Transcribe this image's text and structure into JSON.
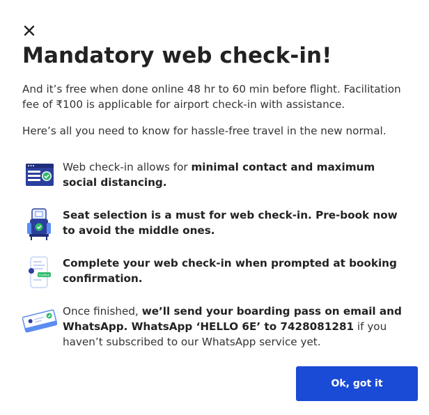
{
  "dialog": {
    "close_icon": "close-icon",
    "title": "Mandatory web check-in!",
    "intro": "And it’s free when done online 48 hr to 60 min before flight. Facilitation fee of ₹100 is applicable for airport check-in with assistance.",
    "subintro": "Here’s all you need to know for hassle-free travel in the new normal.",
    "features": [
      {
        "icon": "web-checkin-browser-icon",
        "text_before": "Web check-in allows for ",
        "text_bold": "minimal contact and maximum social distancing.",
        "text_after": ""
      },
      {
        "icon": "seat-selection-icon",
        "text_before": "",
        "text_bold": "Seat selection is a must for web check-in. Pre-book now to avoid the middle ones.",
        "text_after": ""
      },
      {
        "icon": "mobile-confirm-icon",
        "icon_badge": "Confirm",
        "text_before": "",
        "text_bold": "Complete your web check-in when prompted at booking confirmation.",
        "text_after": ""
      },
      {
        "icon": "boarding-pass-icon",
        "text_before": "Once finished, ",
        "text_bold": "we’ll send your boarding pass on email and WhatsApp. WhatsApp ‘HELLO 6E’ to 7428081281",
        "text_after": " if you haven’t subscribed to our WhatsApp service yet."
      }
    ],
    "ok_button": "Ok, got it"
  },
  "colors": {
    "primary": "#1a4bd6",
    "icon_dark": "#2c3f9c",
    "icon_light": "#5b8df0",
    "success": "#2fb86a",
    "text": "#333333"
  }
}
